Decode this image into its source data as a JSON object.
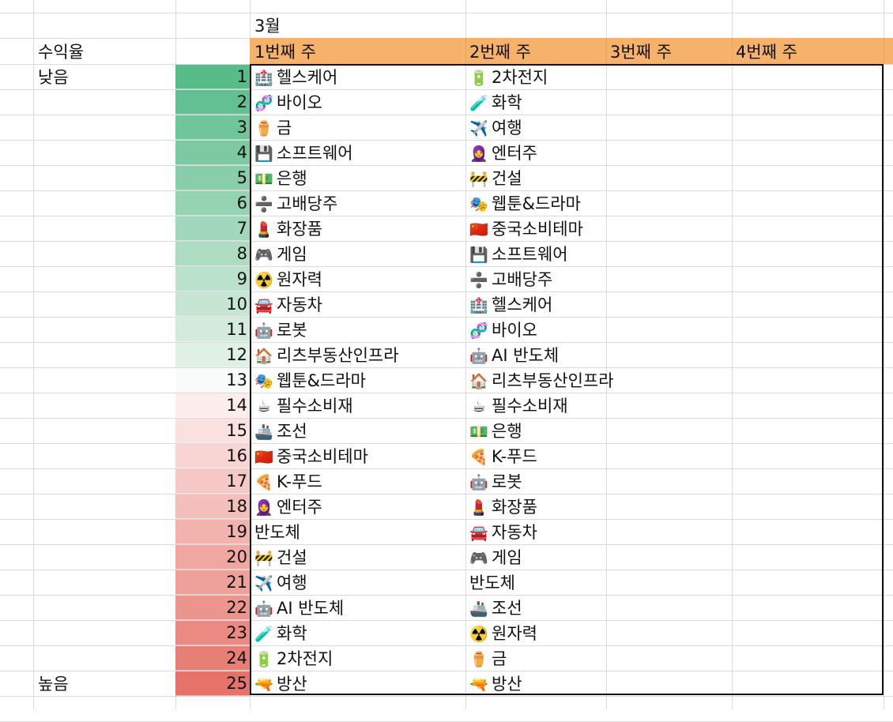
{
  "month": "3월",
  "axis": {
    "title": "수익율",
    "low": "낮음",
    "high": "높음"
  },
  "weeks": [
    "1번째 주",
    "2번째 주",
    "3번째 주",
    "4번째 주"
  ],
  "ranks": [
    1,
    2,
    3,
    4,
    5,
    6,
    7,
    8,
    9,
    10,
    11,
    12,
    13,
    14,
    15,
    16,
    17,
    18,
    19,
    20,
    21,
    22,
    23,
    24,
    25
  ],
  "rank_colors": [
    "#57bb8a",
    "#63c092",
    "#70c59a",
    "#7cc9a2",
    "#88ceab",
    "#95d3b3",
    "#a1d8bb",
    "#aedcc3",
    "#bae1cb",
    "#c6e6d3",
    "#d3ebdc",
    "#dff0e4",
    "#f7fbf9",
    "#fcecec",
    "#fae0df",
    "#f8d5d3",
    "#f6c9c7",
    "#f4bebb",
    "#f2b2ae",
    "#f0a7a2",
    "#eea09a",
    "#ec958e",
    "#ea8a82",
    "#e87f76",
    "#e6736a"
  ],
  "week1": [
    {
      "icon": "🏥",
      "label": "헬스케어"
    },
    {
      "icon": "🧬",
      "label": "바이오"
    },
    {
      "icon": "⚱️",
      "label": "금"
    },
    {
      "icon": "💾",
      "label": "소프트웨어"
    },
    {
      "icon": "💵",
      "label": "은행"
    },
    {
      "icon": "➗",
      "label": "고배당주"
    },
    {
      "icon": "💄",
      "label": "화장품"
    },
    {
      "icon": "🎮",
      "label": "게임"
    },
    {
      "icon": "☢️",
      "label": "원자력"
    },
    {
      "icon": "🚘",
      "label": "자동차"
    },
    {
      "icon": "🤖",
      "label": "로봇"
    },
    {
      "icon": "🏠",
      "label": "리츠부동산인프라"
    },
    {
      "icon": "🎭",
      "label": "웹툰&드라마"
    },
    {
      "icon": "☕",
      "label": "필수소비재"
    },
    {
      "icon": "🚢",
      "label": "조선"
    },
    {
      "icon": "🇨🇳",
      "label": "중국소비테마"
    },
    {
      "icon": "🍕",
      "label": "K-푸드"
    },
    {
      "icon": "🧕",
      "label": "엔터주"
    },
    {
      "icon": "",
      "label": "반도체"
    },
    {
      "icon": "🚧",
      "label": "건설"
    },
    {
      "icon": "✈️",
      "label": "여행"
    },
    {
      "icon": "🤖",
      "label": "AI 반도체"
    },
    {
      "icon": "🧪",
      "label": "화학"
    },
    {
      "icon": "🔋",
      "label": "2차전지"
    },
    {
      "icon": "🔫",
      "label": "방산"
    }
  ],
  "week2": [
    {
      "icon": "🔋",
      "label": "2차전지"
    },
    {
      "icon": "🧪",
      "label": "화학"
    },
    {
      "icon": "✈️",
      "label": "여행"
    },
    {
      "icon": "🧕",
      "label": "엔터주"
    },
    {
      "icon": "🚧",
      "label": "건설"
    },
    {
      "icon": "🎭",
      "label": "웹툰&드라마"
    },
    {
      "icon": "🇨🇳",
      "label": "중국소비테마"
    },
    {
      "icon": "💾",
      "label": "소프트웨어"
    },
    {
      "icon": "➗",
      "label": "고배당주"
    },
    {
      "icon": "🏥",
      "label": "헬스케어"
    },
    {
      "icon": "🧬",
      "label": "바이오"
    },
    {
      "icon": "🤖",
      "label": "AI 반도체"
    },
    {
      "icon": "🏠",
      "label": "리츠부동산인프라"
    },
    {
      "icon": "☕",
      "label": "필수소비재"
    },
    {
      "icon": "💵",
      "label": "은행"
    },
    {
      "icon": "🍕",
      "label": "K-푸드"
    },
    {
      "icon": "🤖",
      "label": "로봇"
    },
    {
      "icon": "💄",
      "label": "화장품"
    },
    {
      "icon": "🚘",
      "label": "자동차"
    },
    {
      "icon": "🎮",
      "label": "게임"
    },
    {
      "icon": "",
      "label": "반도체"
    },
    {
      "icon": "🚢",
      "label": "조선"
    },
    {
      "icon": "☢️",
      "label": "원자력"
    },
    {
      "icon": "⚱️",
      "label": "금"
    },
    {
      "icon": "🔫",
      "label": "방산"
    }
  ]
}
